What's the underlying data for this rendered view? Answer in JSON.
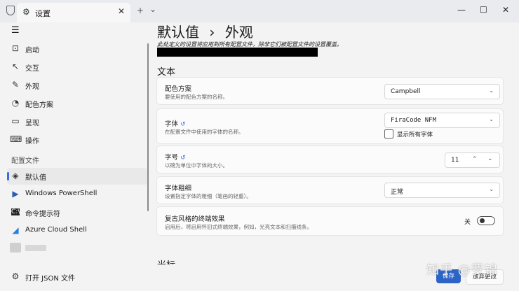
{
  "window": {
    "tab_title": "设置",
    "new_tab": "+",
    "tab_menu": "⌄",
    "minimize": "—",
    "maximize": "☐",
    "close": "✕",
    "tab_close": "✕"
  },
  "sidebar": {
    "menu_icon": "☰",
    "items": [
      {
        "label": "启动",
        "icon": "launch-icon"
      },
      {
        "label": "交互",
        "icon": "interaction-icon"
      },
      {
        "label": "外观",
        "icon": "brush-icon"
      },
      {
        "label": "配色方案",
        "icon": "palette-icon"
      },
      {
        "label": "呈现",
        "icon": "monitor-icon"
      },
      {
        "label": "操作",
        "icon": "keyboard-icon"
      }
    ],
    "section_label": "配置文件",
    "profiles": [
      {
        "label": "默认值",
        "icon": "layers-icon",
        "active": true
      },
      {
        "label": "Windows PowerShell",
        "icon": "powershell-icon"
      },
      {
        "label": "命令提示符",
        "icon": "cmd-icon"
      },
      {
        "label": "Azure Cloud Shell",
        "icon": "azure-icon"
      }
    ],
    "open_json": "打开 JSON 文件"
  },
  "main": {
    "breadcrumb_parent": "默认值",
    "breadcrumb_sep": "›",
    "breadcrumb_current": "外观",
    "description": "此处定义的设置将应用到所有配置文件，除非它们被配置文件的设置覆盖。",
    "section_text": "文本",
    "section_cursor": "光标",
    "settings": {
      "color_scheme": {
        "title": "配色方案",
        "subtitle": "要使用的配色方案的名称。",
        "value": "Campbell"
      },
      "font_face": {
        "title": "字体",
        "subtitle": "在配置文件中使用的字体的名称。",
        "value": "FiraCode NFM",
        "show_all_label": "显示所有字体",
        "show_all_checked": false
      },
      "font_size": {
        "title": "字号",
        "subtitle": "以磅为单位中字体的大小。",
        "value": "11"
      },
      "font_weight": {
        "title": "字体粗细",
        "subtitle": "设置指定字体的粗细（笔画的轻重）。",
        "value": "正常"
      },
      "retro": {
        "title": "复古风格的终端效果",
        "subtitle": "启用后，将启用怀旧式终端效果，例如，光亮文本和扫描线条。",
        "state_label": "关",
        "enabled": false
      }
    }
  },
  "footer": {
    "save": "保存",
    "discard": "放弃更改"
  },
  "watermark": "知乎 @罗锦"
}
